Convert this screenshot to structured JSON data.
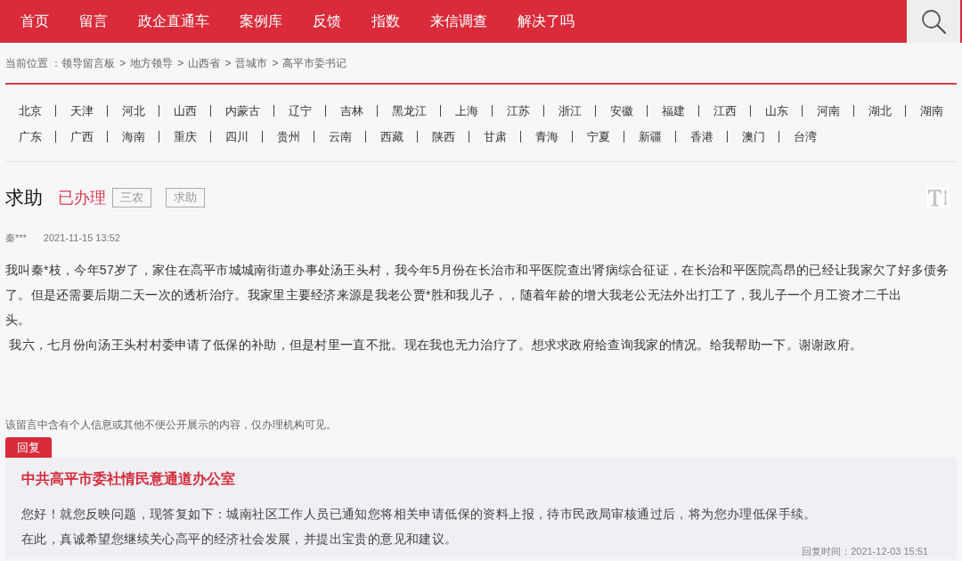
{
  "nav": {
    "items": [
      {
        "label": "首页",
        "selected": false
      },
      {
        "label": "留言",
        "selected": false
      },
      {
        "label": "政企直通车",
        "selected": false
      },
      {
        "label": "案例库",
        "selected": false
      },
      {
        "label": "反馈",
        "selected": false
      },
      {
        "label": "指数",
        "selected": false
      },
      {
        "label": "来信调查",
        "selected": false
      },
      {
        "label": "解决了吗",
        "selected": false
      }
    ]
  },
  "breadcrumb": {
    "label": "当前位置 ：",
    "items": [
      {
        "kind": "link",
        "text": "领导留言板"
      },
      {
        "kind": "separator",
        "text": ">"
      },
      {
        "kind": "link",
        "text": "地方领导"
      },
      {
        "kind": "separator",
        "text": ">"
      },
      {
        "kind": "link",
        "text": "山西省"
      },
      {
        "kind": "separator",
        "text": ">"
      },
      {
        "kind": "link",
        "text": "晋城市"
      },
      {
        "kind": "separator",
        "text": ">"
      },
      {
        "kind": "link",
        "text": "高平市委书记"
      }
    ]
  },
  "region_rows": [
    [
      "北京",
      "天津",
      "河北",
      "山西",
      "内蒙古",
      "辽宁",
      "吉林",
      "黑龙江",
      "上海",
      "江苏",
      "浙江",
      "安徽",
      "福建",
      "江西",
      "山东",
      "河南",
      "湖北",
      "湖南"
    ],
    [
      "广东",
      "广西",
      "海南",
      "重庆",
      "四川",
      "贵州",
      "云南",
      "西藏",
      "陕西",
      "甘肃",
      "青海",
      "宁夏",
      "新疆",
      "香港",
      "澳门",
      "台湾"
    ]
  ],
  "message": {
    "title": "求助",
    "status": "已办理",
    "tags": [
      "三农",
      "求助"
    ],
    "author": "秦***",
    "date": "2021-11-15 13:52",
    "paragraphs": [
      "我叫秦*枝，今年57岁了，家住在高平市城城南街道办事处汤王头村，我今年5月份在长治市和平医院查出肾病综合征证，在长治和平医院高昂的已经让我家欠了好多债务了。但是还需要后期二天一次的透析治疗。我家里主要经济来源是我老公贾*胜和我儿子，，随着年龄的增大我老公无法外出打工了，我儿子一个月工资才二千出",
      "头。",
      " 我六，七月份向汤王头村村委申请了低保的补助，但是村里一直不批。现在我也无力治疗了。想求求政府给查询我家的情况。给我帮助一下。谢谢政府。"
    ]
  },
  "privacy_notice": "该留言中含有个人信息或其他不便公开展示的内容，仅办理机构可见。",
  "reply": {
    "tab": "回复",
    "office": "中共高平市委社情民意通道办公室",
    "paragraphs": [
      "您好！就您反映问题，现答复如下：城南社区工作人员已通知您将相关申请低保的资料上报，待市民政局审核通过后，将为您办理低保手续。",
      "在此，真诚希望您继续关心高平的经济社会发展，并提出宝贵的意见和建议。"
    ],
    "time": "回复时间：2021-12-03 15:51"
  }
}
